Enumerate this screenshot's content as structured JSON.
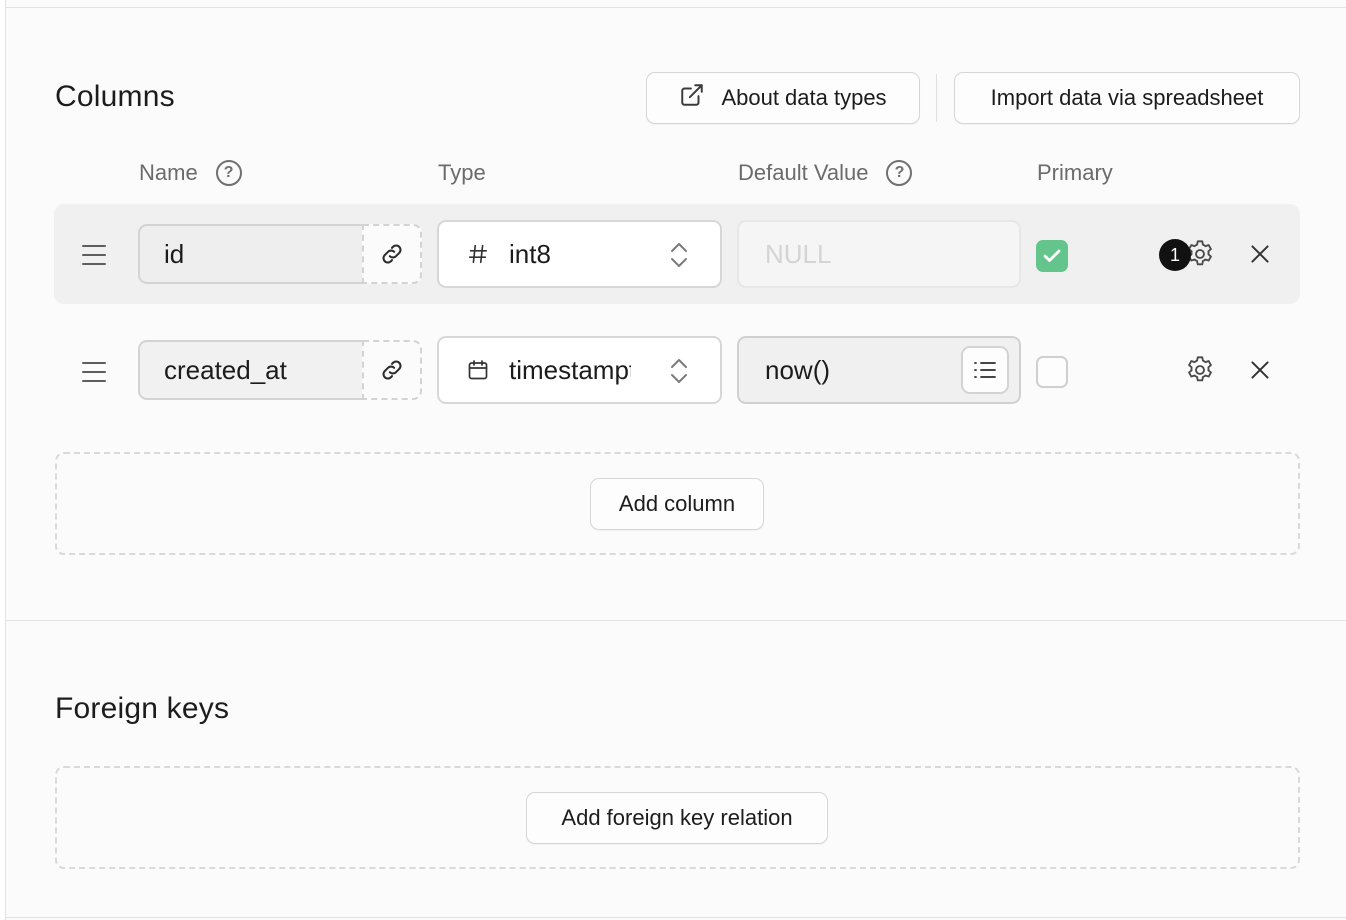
{
  "columns_section": {
    "title": "Columns",
    "about_button": {
      "label": "About data types",
      "icon": "external-link-icon"
    },
    "import_button": {
      "label": "Import data via spreadsheet"
    },
    "headers": {
      "name": "Name",
      "type": "Type",
      "default_value": "Default Value",
      "primary": "Primary"
    },
    "rows": [
      {
        "name": "id",
        "type": "int8",
        "type_icon": "hash-icon",
        "default_value": "",
        "default_placeholder": "NULL",
        "primary": true,
        "settings_badge": "1"
      },
      {
        "name": "created_at",
        "type": "timestamptz",
        "type_icon": "calendar-icon",
        "default_value": "now()",
        "default_placeholder": "",
        "primary": false
      }
    ],
    "add_column_label": "Add column"
  },
  "foreign_keys_section": {
    "title": "Foreign keys",
    "add_relation_label": "Add foreign key relation"
  },
  "colors": {
    "primary_checked": "#63c58c",
    "badge_bg": "#111111"
  }
}
